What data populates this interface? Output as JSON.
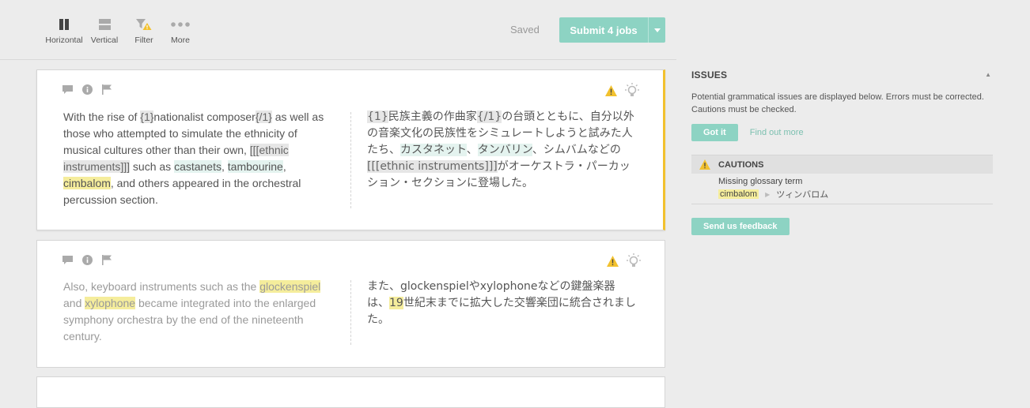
{
  "toolbar": {
    "tools": [
      {
        "label": "Horizontal",
        "icon": "pause-bars-icon"
      },
      {
        "label": "Vertical",
        "icon": "stacked-rows-icon"
      },
      {
        "label": "Filter",
        "icon": "filter-warning-icon"
      },
      {
        "label": "More",
        "icon": "more-dots-icon"
      }
    ],
    "saved_label": "Saved",
    "submit_label": "Submit 4 jobs"
  },
  "segments": [
    {
      "source": [
        {
          "t": "With the rise of "
        },
        {
          "t": "{1}",
          "c": "tag"
        },
        {
          "t": "nationalist composer"
        },
        {
          "t": "{/1}",
          "c": "tag"
        },
        {
          "t": " as well as those who attempted to simulate the ethnicity of musical cultures other than their own, "
        },
        {
          "t": "[[[ethnic instruments]]]",
          "c": "tag"
        },
        {
          "t": " such as "
        },
        {
          "t": "castanets",
          "c": "tg"
        },
        {
          "t": ", "
        },
        {
          "t": "tambourine",
          "c": "tg"
        },
        {
          "t": ", "
        },
        {
          "t": "cimbalom",
          "c": "ty"
        },
        {
          "t": ", and others appeared in the orchestral percussion section."
        }
      ],
      "target": [
        {
          "t": "{1}",
          "c": "tag"
        },
        {
          "t": "民族主義の作曲家"
        },
        {
          "t": "{/1}",
          "c": "tag"
        },
        {
          "t": "の台頭とともに、自分以外の音楽文化の民族性をシミュレートしようと試みた人たち、"
        },
        {
          "t": "カスタネット",
          "c": "tg"
        },
        {
          "t": "、"
        },
        {
          "t": "タンバリン",
          "c": "tg"
        },
        {
          "t": "、シムバムなどの"
        },
        {
          "t": "[[[ethnic instruments]]]",
          "c": "tag"
        },
        {
          "t": "がオーケストラ・パーカッション・セクションに登場した。"
        }
      ]
    },
    {
      "source": [
        {
          "t": "Also, keyboard instruments such as the "
        },
        {
          "t": "glockenspiel",
          "c": "ty"
        },
        {
          "t": " and "
        },
        {
          "t": "xylophone",
          "c": "ty"
        },
        {
          "t": " became integrated into the enlarged symphony orchestra by the end of the nineteenth century."
        }
      ],
      "target": [
        {
          "t": "また、glockenspielやxylophoneなどの鍵盤楽器は、"
        },
        {
          "t": "19",
          "c": "ty"
        },
        {
          "t": "世紀末までに拡大した交響楽団に統合されました。"
        }
      ]
    }
  ],
  "issues": {
    "title": "ISSUES",
    "description": "Potential grammatical issues are displayed below. Errors must be corrected. Cautions must be checked.",
    "got_it_label": "Got it",
    "find_out_more_label": "Find out more",
    "cautions_title": "CAUTIONS",
    "caution_item": {
      "title": "Missing glossary term",
      "source_term": "cimbalom",
      "target_term": "ツィンバロム"
    },
    "feedback_label": "Send us feedback"
  },
  "colors": {
    "accent_teal": "#8dd3c3",
    "warning_yellow": "#f2c12e",
    "highlight_yellow": "#f5ed9c",
    "highlight_green": "#e4f3ef"
  }
}
